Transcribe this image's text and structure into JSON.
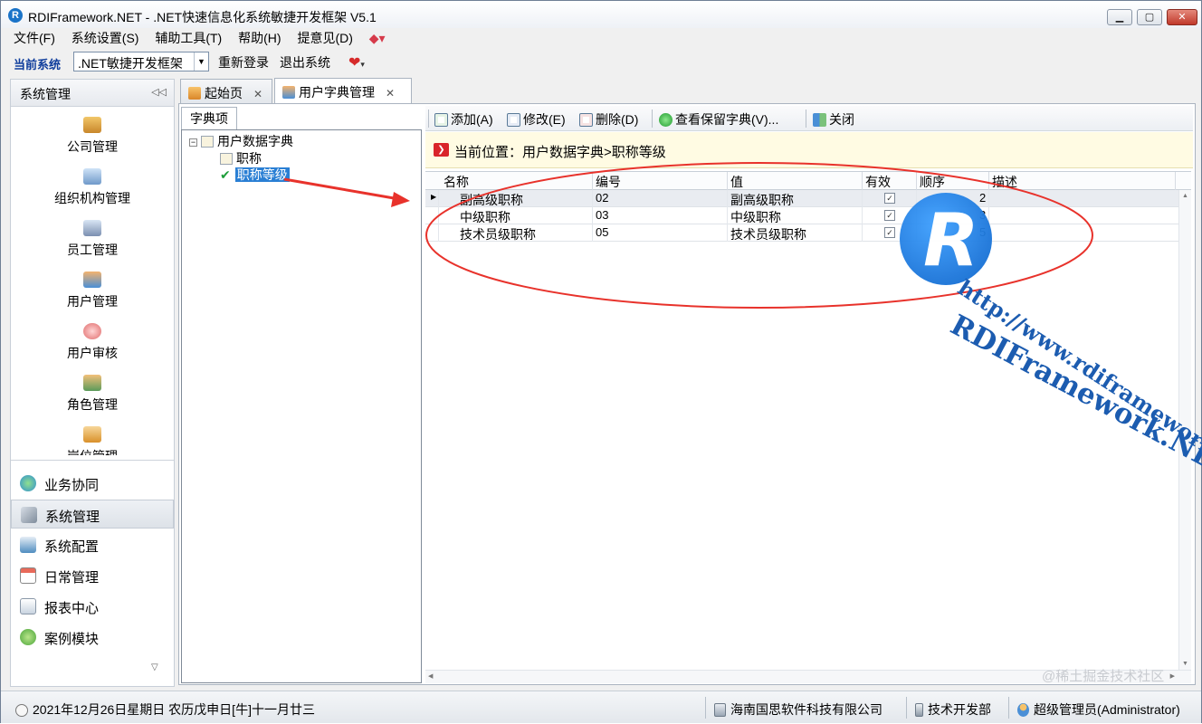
{
  "window": {
    "title": "RDIFramework.NET - .NET快速信息化系统敏捷开发框架 V5.1",
    "app_icon_letter": "R"
  },
  "menu": [
    "文件(F)",
    "系统设置(S)",
    "辅助工具(T)",
    "帮助(H)",
    "提意见(D)"
  ],
  "toolbar": {
    "current_system_label": "当前系统",
    "system_value": ".NET敏捷开发框架",
    "relogin": "重新登录",
    "exit": "退出系统"
  },
  "left_panel": {
    "header": "系统管理",
    "modules": [
      "公司管理",
      "组织机构管理",
      "员工管理",
      "用户管理",
      "用户审核",
      "角色管理",
      "岗位管理"
    ],
    "nav": [
      "业务协同",
      "系统管理",
      "系统配置",
      "日常管理",
      "报表中心",
      "案例模块"
    ],
    "active_nav": "系统管理"
  },
  "tabs": [
    {
      "label": "起始页"
    },
    {
      "label": "用户字典管理"
    }
  ],
  "dictionary": {
    "panel_tab": "字典项",
    "root": "用户数据字典",
    "children": [
      "职称",
      "职称等级"
    ],
    "selected": "职称等级"
  },
  "actions": {
    "add": "添加(A)",
    "edit": "修改(E)",
    "delete": "删除(D)",
    "view_reserved": "查看保留字典(V)...",
    "close": "关闭"
  },
  "location": "当前位置：用户数据字典>职称等级",
  "grid": {
    "columns": [
      "名称",
      "编号",
      "值",
      "有效",
      "顺序",
      "描述"
    ],
    "rows": [
      {
        "name": "副高级职称",
        "code": "02",
        "value": "副高级职称",
        "enabled": true,
        "order": "2",
        "desc": ""
      },
      {
        "name": "中级职称",
        "code": "03",
        "value": "中级职称",
        "enabled": true,
        "order": "3",
        "desc": ""
      },
      {
        "name": "技术员级职称",
        "code": "05",
        "value": "技术员级职称",
        "enabled": true,
        "order": "5",
        "desc": ""
      }
    ]
  },
  "watermark": {
    "logo_letter": "R",
    "brand": "RDIFramework.NET",
    "url": "http://www.rdiframework.net",
    "juejin": "@稀土掘金技术社区"
  },
  "statusbar": {
    "date": "2021年12月26日星期日 农历戊申日[牛]十一月廿三",
    "company": "海南国思软件科技有限公司",
    "department": "技术开发部",
    "user": "超级管理员(Administrator)"
  },
  "colors": {
    "accent": "#2a7fd4",
    "annotation_red": "#e8322b",
    "location_bg": "#fffbe3"
  }
}
